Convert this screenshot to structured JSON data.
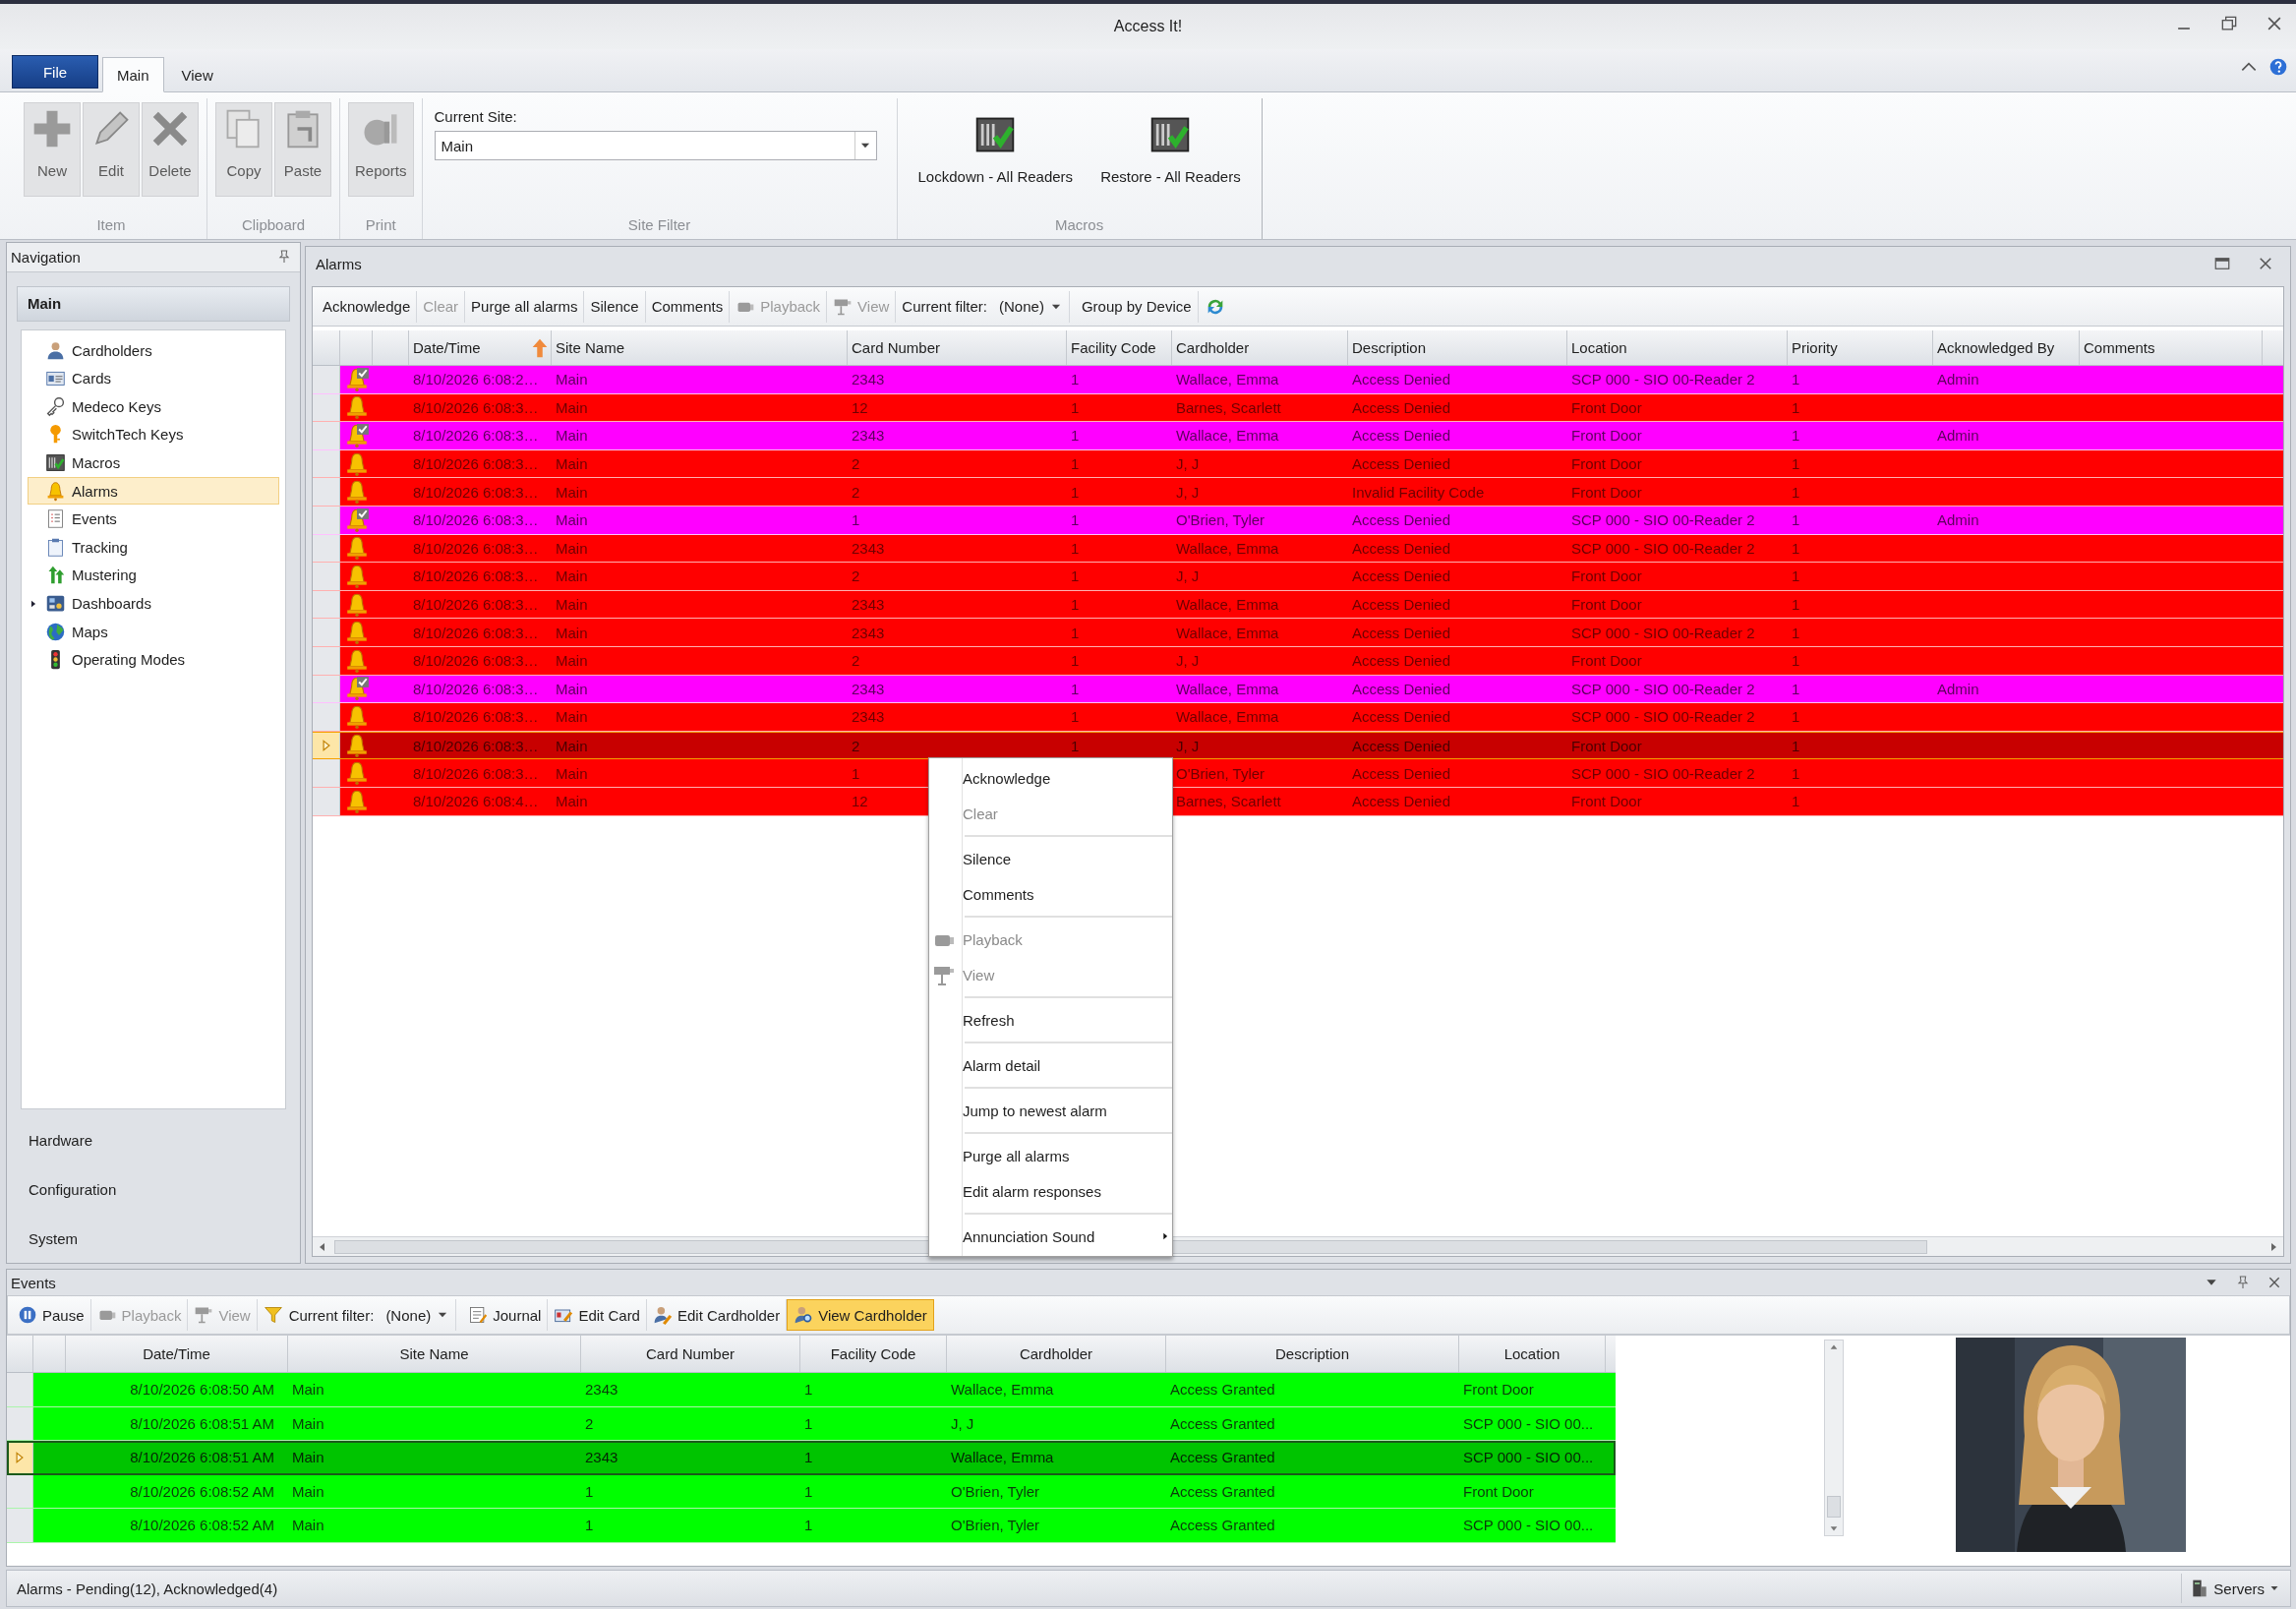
{
  "window": {
    "title": "Access It!"
  },
  "ribbon": {
    "tabs": [
      {
        "label": "File",
        "kind": "file",
        "selected": false
      },
      {
        "label": "Main",
        "kind": "tab",
        "selected": true
      },
      {
        "label": "View",
        "kind": "tab",
        "selected": false
      }
    ],
    "groups": [
      {
        "label": "Item",
        "kind": "buttons",
        "buttons": [
          {
            "label": "New",
            "disabled": true
          },
          {
            "label": "Edit",
            "disabled": true
          },
          {
            "label": "Delete",
            "disabled": true
          }
        ]
      },
      {
        "label": "Clipboard",
        "kind": "buttons",
        "buttons": [
          {
            "label": "Copy",
            "disabled": true
          },
          {
            "label": "Paste",
            "disabled": true
          }
        ]
      },
      {
        "label": "Print",
        "kind": "buttons",
        "buttons": [
          {
            "label": "Reports",
            "disabled": true
          }
        ]
      },
      {
        "label": "Site Filter",
        "kind": "site",
        "field_label": "Current Site:",
        "value": "Main"
      },
      {
        "label": "Macros",
        "kind": "buttons",
        "buttons": [
          {
            "label": "Lockdown - All Readers",
            "disabled": false
          },
          {
            "label": "Restore - All Readers",
            "disabled": false
          }
        ]
      }
    ]
  },
  "navigation": {
    "title": "Navigation",
    "group": "Main",
    "items": [
      {
        "label": "Cardholders",
        "selected": false
      },
      {
        "label": "Cards",
        "selected": false
      },
      {
        "label": "Medeco Keys",
        "selected": false
      },
      {
        "label": "SwitchTech Keys",
        "selected": false
      },
      {
        "label": "Macros",
        "selected": false
      },
      {
        "label": "Alarms",
        "selected": true
      },
      {
        "label": "Events",
        "selected": false
      },
      {
        "label": "Tracking",
        "selected": false
      },
      {
        "label": "Mustering",
        "selected": false
      },
      {
        "label": "Dashboards",
        "selected": false,
        "expanded": false
      },
      {
        "label": "Maps",
        "selected": false
      },
      {
        "label": "Operating Modes",
        "selected": false
      }
    ],
    "sections": [
      "Hardware",
      "Configuration",
      "System"
    ]
  },
  "alarms": {
    "title": "Alarms",
    "toolbar": [
      {
        "kind": "button",
        "label": "Acknowledge",
        "disabled": false
      },
      {
        "kind": "button",
        "label": "Clear",
        "disabled": true
      },
      {
        "kind": "button",
        "label": "Purge all alarms",
        "disabled": false
      },
      {
        "kind": "button",
        "label": "Silence",
        "disabled": false
      },
      {
        "kind": "button",
        "label": "Comments",
        "disabled": false
      },
      {
        "kind": "button",
        "label": "Playback",
        "disabled": true
      },
      {
        "kind": "button",
        "label": "View",
        "disabled": true
      },
      {
        "kind": "filter",
        "label": "Current filter:",
        "value": "(None)"
      },
      {
        "kind": "button",
        "label": "Group by Device",
        "disabled": false
      },
      {
        "kind": "icon-button",
        "disabled": false
      }
    ],
    "columns": [
      {
        "label": "Date/Time",
        "sorted": true
      },
      {
        "label": "Site Name",
        "sorted": false
      },
      {
        "label": "Card Number",
        "sorted": false
      },
      {
        "label": "Facility Code",
        "sorted": false
      },
      {
        "label": "Cardholder",
        "sorted": false
      },
      {
        "label": "Description",
        "sorted": false
      },
      {
        "label": "Location",
        "sorted": false
      },
      {
        "label": "Priority",
        "sorted": false
      },
      {
        "label": "Acknowledged By",
        "sorted": false
      },
      {
        "label": "Comments",
        "sorted": false
      }
    ],
    "rows": [
      {
        "acknowledged": true,
        "selected": false,
        "date_time": "8/10/2026 6:08:2…",
        "site_name": "Main",
        "card_number": "2343",
        "facility_code": "1",
        "cardholder": "Wallace, Emma",
        "description": "Access Denied",
        "location": "SCP 000 - SIO 00-Reader 2",
        "priority": "1",
        "acknowledged_by": "Admin"
      },
      {
        "acknowledged": false,
        "selected": false,
        "date_time": "8/10/2026 6:08:3…",
        "site_name": "Main",
        "card_number": "12",
        "facility_code": "1",
        "cardholder": "Barnes, Scarlett",
        "description": "Access Denied",
        "location": "Front Door",
        "priority": "1"
      },
      {
        "acknowledged": true,
        "selected": false,
        "date_time": "8/10/2026 6:08:3…",
        "site_name": "Main",
        "card_number": "2343",
        "facility_code": "1",
        "cardholder": "Wallace, Emma",
        "description": "Access Denied",
        "location": "Front Door",
        "priority": "1",
        "acknowledged_by": "Admin"
      },
      {
        "acknowledged": false,
        "selected": false,
        "date_time": "8/10/2026 6:08:3…",
        "site_name": "Main",
        "card_number": "2",
        "facility_code": "1",
        "cardholder": "J, J",
        "description": "Access Denied",
        "location": "Front Door",
        "priority": "1"
      },
      {
        "acknowledged": false,
        "selected": false,
        "date_time": "8/10/2026 6:08:3…",
        "site_name": "Main",
        "card_number": "2",
        "facility_code": "1",
        "cardholder": "J, J",
        "description": "Invalid Facility Code",
        "location": "Front Door",
        "priority": "1"
      },
      {
        "acknowledged": true,
        "selected": false,
        "date_time": "8/10/2026 6:08:3…",
        "site_name": "Main",
        "card_number": "1",
        "facility_code": "1",
        "cardholder": "O'Brien, Tyler",
        "description": "Access Denied",
        "location": "SCP 000 - SIO 00-Reader 2",
        "priority": "1",
        "acknowledged_by": "Admin"
      },
      {
        "acknowledged": false,
        "selected": false,
        "date_time": "8/10/2026 6:08:3…",
        "site_name": "Main",
        "card_number": "2343",
        "facility_code": "1",
        "cardholder": "Wallace, Emma",
        "description": "Access Denied",
        "location": "SCP 000 - SIO 00-Reader 2",
        "priority": "1"
      },
      {
        "acknowledged": false,
        "selected": false,
        "date_time": "8/10/2026 6:08:3…",
        "site_name": "Main",
        "card_number": "2",
        "facility_code": "1",
        "cardholder": "J, J",
        "description": "Access Denied",
        "location": "Front Door",
        "priority": "1"
      },
      {
        "acknowledged": false,
        "selected": false,
        "date_time": "8/10/2026 6:08:3…",
        "site_name": "Main",
        "card_number": "2343",
        "facility_code": "1",
        "cardholder": "Wallace, Emma",
        "description": "Access Denied",
        "location": "Front Door",
        "priority": "1"
      },
      {
        "acknowledged": false,
        "selected": false,
        "date_time": "8/10/2026 6:08:3…",
        "site_name": "Main",
        "card_number": "2343",
        "facility_code": "1",
        "cardholder": "Wallace, Emma",
        "description": "Access Denied",
        "location": "SCP 000 - SIO 00-Reader 2",
        "priority": "1"
      },
      {
        "acknowledged": false,
        "selected": false,
        "date_time": "8/10/2026 6:08:3…",
        "site_name": "Main",
        "card_number": "2",
        "facility_code": "1",
        "cardholder": "J, J",
        "description": "Access Denied",
        "location": "Front Door",
        "priority": "1"
      },
      {
        "acknowledged": true,
        "selected": false,
        "date_time": "8/10/2026 6:08:3…",
        "site_name": "Main",
        "card_number": "2343",
        "facility_code": "1",
        "cardholder": "Wallace, Emma",
        "description": "Access Denied",
        "location": "SCP 000 - SIO 00-Reader 2",
        "priority": "1",
        "acknowledged_by": "Admin"
      },
      {
        "acknowledged": false,
        "selected": false,
        "date_time": "8/10/2026 6:08:3…",
        "site_name": "Main",
        "card_number": "2343",
        "facility_code": "1",
        "cardholder": "Wallace, Emma",
        "description": "Access Denied",
        "location": "SCP 000 - SIO 00-Reader 2",
        "priority": "1"
      },
      {
        "acknowledged": false,
        "selected": true,
        "date_time": "8/10/2026 6:08:3…",
        "site_name": "Main",
        "card_number": "2",
        "facility_code": "1",
        "cardholder": "J, J",
        "description": "Access Denied",
        "location": "Front Door",
        "priority": "1"
      },
      {
        "acknowledged": false,
        "selected": false,
        "date_time": "8/10/2026 6:08:3…",
        "site_name": "Main",
        "card_number": "1",
        "cardholder": "O'Brien, Tyler",
        "description": "Access Denied",
        "location": "SCP 000 - SIO 00-Reader 2",
        "priority": "1"
      },
      {
        "acknowledged": false,
        "selected": false,
        "date_time": "8/10/2026 6:08:4…",
        "site_name": "Main",
        "card_number": "12",
        "cardholder": "Barnes, Scarlett",
        "description": "Access Denied",
        "location": "Front Door",
        "priority": "1"
      }
    ]
  },
  "context_menu": {
    "groups": [
      [
        {
          "label": "Acknowledge",
          "disabled": false
        },
        {
          "label": "Clear",
          "disabled": true
        }
      ],
      [
        {
          "label": "Silence",
          "disabled": false
        },
        {
          "label": "Comments",
          "disabled": false
        }
      ],
      [
        {
          "label": "Playback",
          "disabled": true
        },
        {
          "label": "View",
          "disabled": true
        }
      ],
      [
        {
          "label": "Refresh",
          "disabled": false
        }
      ],
      [
        {
          "label": "Alarm detail",
          "disabled": false
        }
      ],
      [
        {
          "label": "Jump to newest alarm",
          "disabled": false
        }
      ],
      [
        {
          "label": "Purge all alarms",
          "disabled": false
        },
        {
          "label": "Edit alarm responses",
          "disabled": false
        }
      ],
      [
        {
          "label": "Annunciation Sound",
          "disabled": false,
          "submenu": true
        }
      ]
    ]
  },
  "events": {
    "title": "Events",
    "toolbar": [
      {
        "kind": "button",
        "label": "Pause",
        "disabled": false,
        "pressed": false
      },
      {
        "kind": "button",
        "label": "Playback",
        "disabled": true,
        "pressed": false
      },
      {
        "kind": "button",
        "label": "View",
        "disabled": true,
        "pressed": false
      },
      {
        "kind": "filter",
        "label": "Current filter:",
        "value": "(None)"
      },
      {
        "kind": "button",
        "label": "Journal",
        "disabled": false,
        "pressed": false
      },
      {
        "kind": "button",
        "label": "Edit Card",
        "disabled": false,
        "pressed": false
      },
      {
        "kind": "button",
        "label": "Edit Cardholder",
        "disabled": false,
        "pressed": false
      },
      {
        "kind": "button",
        "label": "View Cardholder",
        "disabled": false,
        "pressed": true
      }
    ],
    "columns": [
      "Date/Time",
      "Site Name",
      "Card Number",
      "Facility Code",
      "Cardholder",
      "Description",
      "Location"
    ],
    "rows": [
      {
        "selected": false,
        "date_time": "8/10/2026 6:08:50 AM",
        "site_name": "Main",
        "card_number": "2343",
        "facility_code": "1",
        "cardholder": "Wallace, Emma",
        "description": "Access Granted",
        "location": "Front Door"
      },
      {
        "selected": false,
        "date_time": "8/10/2026 6:08:51 AM",
        "site_name": "Main",
        "card_number": "2",
        "facility_code": "1",
        "cardholder": "J, J",
        "description": "Access Granted",
        "location": "SCP 000 - SIO 00..."
      },
      {
        "selected": true,
        "date_time": "8/10/2026 6:08:51 AM",
        "site_name": "Main",
        "card_number": "2343",
        "facility_code": "1",
        "cardholder": "Wallace, Emma",
        "description": "Access Granted",
        "location": "SCP 000 - SIO 00..."
      },
      {
        "selected": false,
        "date_time": "8/10/2026 6:08:52 AM",
        "site_name": "Main",
        "card_number": "1",
        "facility_code": "1",
        "cardholder": "O'Brien, Tyler",
        "description": "Access Granted",
        "location": "Front Door"
      },
      {
        "selected": false,
        "date_time": "8/10/2026 6:08:52 AM",
        "site_name": "Main",
        "card_number": "1",
        "facility_code": "1",
        "cardholder": "O'Brien, Tyler",
        "description": "Access Granted",
        "location": "SCP 000 - SIO 00..."
      }
    ],
    "photo": {
      "kind": "picture"
    }
  },
  "status_bar": {
    "text": "Alarms - Pending(12), Acknowledged(4)",
    "servers": "Servers"
  }
}
